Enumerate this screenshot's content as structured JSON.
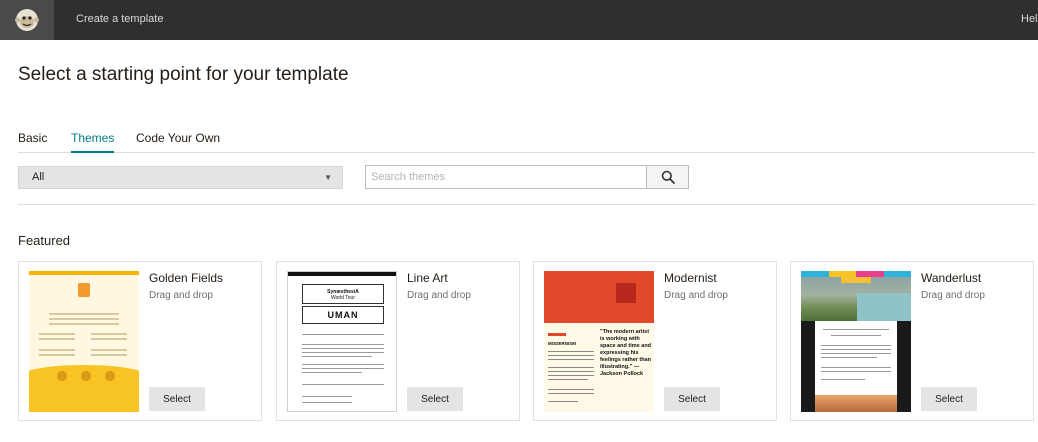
{
  "topbar": {
    "title": "Create a template",
    "help": "Help"
  },
  "page": {
    "title": "Select a starting point for your template"
  },
  "tabs": [
    {
      "label": "Basic",
      "active": false
    },
    {
      "label": "Themes",
      "active": true
    },
    {
      "label": "Code Your Own",
      "active": false
    }
  ],
  "filter": {
    "selected": "All"
  },
  "search": {
    "placeholder": "Search themes",
    "value": ""
  },
  "section": {
    "featured": "Featured"
  },
  "cards": [
    {
      "name": "Golden Fields",
      "type": "Drag and drop",
      "button": "Select"
    },
    {
      "name": "Line Art",
      "type": "Drag and drop",
      "button": "Select"
    },
    {
      "name": "Modernist",
      "type": "Drag and drop",
      "button": "Select"
    },
    {
      "name": "Wanderlust",
      "type": "Drag and drop",
      "button": "Select"
    }
  ],
  "thumbnails": {
    "line_art": {
      "title": "SynæsthesiA",
      "subtitle": "World Tour",
      "logo": "UMAN"
    },
    "modernist": {
      "quote": "\"The modern artist is working with space and time and expressing his feelings rather than illustrating.\" — Jackson Pollock",
      "heading": "MODERNISM"
    }
  },
  "colors": {
    "accent": "#007c89",
    "topbar": "#2f2f2f",
    "button": "#e4e4e4"
  },
  "icons": {
    "logo": "monkey-logo-icon",
    "search": "search-icon",
    "dropdown": "chevron-down-icon"
  }
}
